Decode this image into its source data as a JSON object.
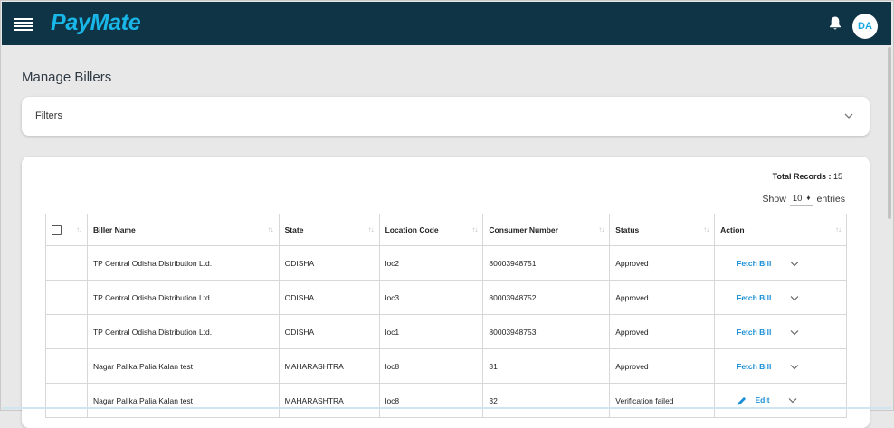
{
  "app": {
    "logo": "PayMate",
    "avatar_initials": "DA",
    "brand_color": "#19b7e8",
    "topbar_color": "#0e3446"
  },
  "page": {
    "title": "Manage Billers"
  },
  "filters": {
    "label": "Filters"
  },
  "records": {
    "total_label": "Total Records :",
    "total_value": "15",
    "show_label": "Show",
    "entries_value": "10",
    "entries_label": "entries"
  },
  "table": {
    "headers": [
      "Biller Name",
      "State",
      "Location Code",
      "Consumer Number",
      "Status",
      "Action"
    ],
    "rows": [
      {
        "biller": "TP Central Odisha Distribution Ltd.",
        "state": "ODISHA",
        "location": "loc2",
        "consumer": "80003948751",
        "status": "Approved",
        "action": "Fetch Bill",
        "action_type": "fetch"
      },
      {
        "biller": "TP Central Odisha Distribution Ltd.",
        "state": "ODISHA",
        "location": "loc3",
        "consumer": "80003948752",
        "status": "Approved",
        "action": "Fetch Bill",
        "action_type": "fetch"
      },
      {
        "biller": "TP Central Odisha Distribution Ltd.",
        "state": "ODISHA",
        "location": "loc1",
        "consumer": "80003948753",
        "status": "Approved",
        "action": "Fetch Bill",
        "action_type": "fetch"
      },
      {
        "biller": "Nagar Palika Palia Kalan test",
        "state": "MAHARASHTRA",
        "location": "loc8",
        "consumer": "31",
        "status": "Approved",
        "action": "Fetch Bill",
        "action_type": "fetch"
      },
      {
        "biller": "Nagar Palika Palia Kalan test",
        "state": "MAHARASHTRA",
        "location": "loc8",
        "consumer": "32",
        "status": "Verification failed",
        "action": "Edit",
        "action_type": "edit"
      }
    ]
  },
  "icons": {
    "menu": "hamburger-icon",
    "bell": "bell-icon",
    "chevron": "chevron-down-icon",
    "edit": "pencil-icon",
    "sort": "sort-icon"
  }
}
